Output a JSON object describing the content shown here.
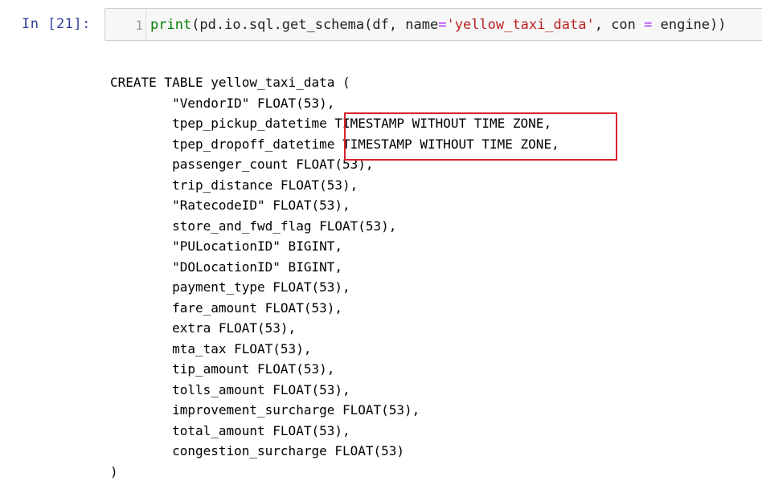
{
  "cell": {
    "prompt": "In  [21]:",
    "line_number": "1",
    "code": {
      "fn": "print",
      "part1": "(pd.io.sql.get_schema(df, name",
      "eq1": "=",
      "str": "'yellow_taxi_data'",
      "part2": ", con ",
      "eq2": "=",
      "part3": " engine))"
    }
  },
  "output": {
    "lines": [
      "CREATE TABLE yellow_taxi_data (",
      "        \"VendorID\" FLOAT(53),",
      "        tpep_pickup_datetime TIMESTAMP WITHOUT TIME ZONE,",
      "        tpep_dropoff_datetime TIMESTAMP WITHOUT TIME ZONE,",
      "        passenger_count FLOAT(53),",
      "        trip_distance FLOAT(53),",
      "        \"RatecodeID\" FLOAT(53),",
      "        store_and_fwd_flag FLOAT(53),",
      "        \"PULocationID\" BIGINT,",
      "        \"DOLocationID\" BIGINT,",
      "        payment_type FLOAT(53),",
      "        fare_amount FLOAT(53),",
      "        extra FLOAT(53),",
      "        mta_tax FLOAT(53),",
      "        tip_amount FLOAT(53),",
      "        tolls_amount FLOAT(53),",
      "        improvement_surcharge FLOAT(53),",
      "        total_amount FLOAT(53),",
      "        congestion_surcharge FLOAT(53)",
      ")"
    ]
  },
  "colors": {
    "prompt": "#303f9f",
    "keyword": "#008000",
    "string": "#ba2121",
    "operator": "#aa22ff",
    "highlight_box": "#d9252d"
  }
}
